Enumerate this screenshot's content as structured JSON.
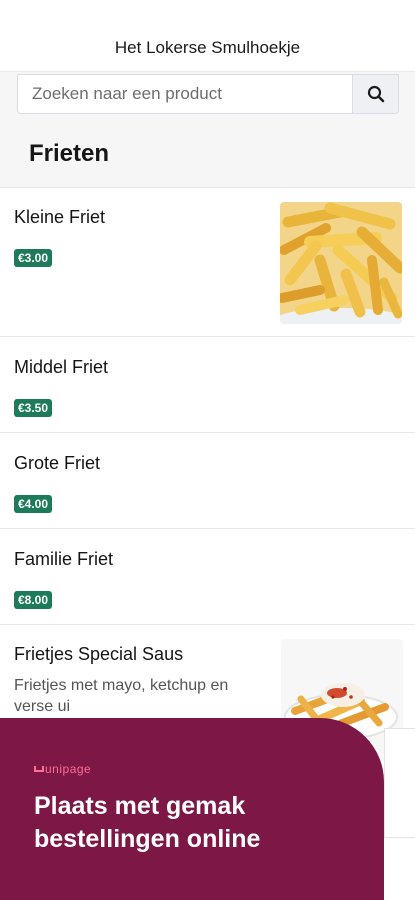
{
  "header": {
    "title": "Het Lokerse Smulhoekje"
  },
  "search": {
    "placeholder": "Zoeken naar een product",
    "icon": "search-icon"
  },
  "category": {
    "title": "Frieten"
  },
  "products": [
    {
      "name": "Kleine Friet",
      "price": "€3.00",
      "has_image": true,
      "image": "fries"
    },
    {
      "name": "Middel Friet",
      "price": "€3.50",
      "has_image": false
    },
    {
      "name": "Grote Friet",
      "price": "€4.00",
      "has_image": false
    },
    {
      "name": "Familie Friet",
      "price": "€8.00",
      "has_image": false
    },
    {
      "name": "Frietjes Special Saus",
      "description": "Frietjes met mayo, ketchup en verse ui",
      "has_image": true,
      "image": "fries-special"
    }
  ],
  "promo": {
    "logo": "unipage",
    "headline": "Plaats met gemak bestellingen online",
    "background": "#7d1745"
  },
  "colors": {
    "price_badge": "#1d7a5a",
    "search_bg": "#f6f6f6"
  }
}
